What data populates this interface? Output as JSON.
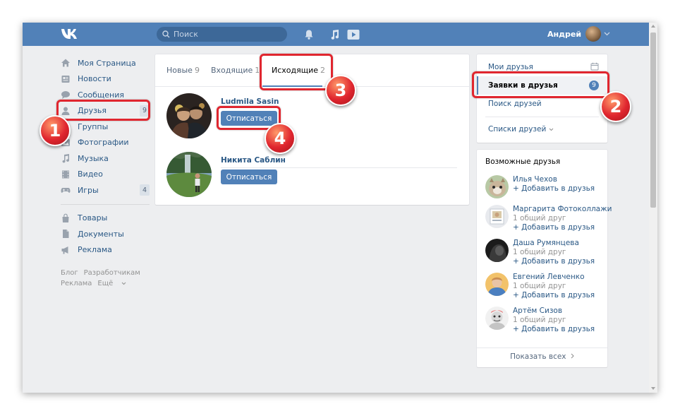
{
  "topbar": {
    "search_placeholder": "Поиск",
    "user_name": "Андрей",
    "colors": {
      "bar": "#5181b8",
      "search_bg": "#3d6898"
    }
  },
  "left_nav": {
    "items": [
      {
        "label": "Моя Страница",
        "icon": "home-icon"
      },
      {
        "label": "Новости",
        "icon": "news-icon"
      },
      {
        "label": "Сообщения",
        "icon": "message-icon"
      },
      {
        "label": "Друзья",
        "icon": "friends-icon",
        "badge": "9"
      },
      {
        "label": "Группы",
        "icon": "groups-icon"
      },
      {
        "label": "Фотографии",
        "icon": "photo-icon"
      },
      {
        "label": "Музыка",
        "icon": "music-icon"
      },
      {
        "label": "Видео",
        "icon": "video-icon"
      },
      {
        "label": "Игры",
        "icon": "games-icon",
        "badge": "4"
      }
    ],
    "items2": [
      {
        "label": "Товары",
        "icon": "bag-icon"
      },
      {
        "label": "Документы",
        "icon": "document-icon"
      },
      {
        "label": "Реклама",
        "icon": "megaphone-icon"
      }
    ],
    "footer": {
      "blog": "Блог",
      "developers": "Разработчикам",
      "ads": "Реклама",
      "more": "Ещё"
    }
  },
  "tabs": [
    {
      "label": "Новые",
      "count": "9"
    },
    {
      "label": "Входящие",
      "count": "13"
    },
    {
      "label": "Исходящие",
      "count": "2",
      "active": true
    }
  ],
  "requests": [
    {
      "name": "Ludmila Sasin",
      "button": "Отписаться"
    },
    {
      "name": "Никита Саблин",
      "button": "Отписаться"
    }
  ],
  "right_nav": {
    "my_friends": "Мои друзья",
    "requests": "Заявки в друзья",
    "requests_badge": "9",
    "search": "Поиск друзей",
    "lists": "Списки друзей"
  },
  "possible_friends": {
    "title": "Возможные друзья",
    "people": [
      {
        "name": "Илья Чехов",
        "mutual": "",
        "add": "Добавить в друзья"
      },
      {
        "name": "Маргарита Фотоколлажи",
        "mutual": "1 общий друг",
        "add": "Добавить в друзья"
      },
      {
        "name": "Даша Румянцева",
        "mutual": "1 общий друг",
        "add": "Добавить в друзья"
      },
      {
        "name": "Евгений Левченко",
        "mutual": "1 общий друг",
        "add": "Добавить в друзья"
      },
      {
        "name": "Артём Сизов",
        "mutual": "1 общий друг",
        "add": "Добавить в друзья"
      }
    ],
    "show_all": "Показать всех"
  },
  "annotations": {
    "markers": [
      "1",
      "2",
      "3",
      "4"
    ],
    "color": "#e0262f"
  }
}
